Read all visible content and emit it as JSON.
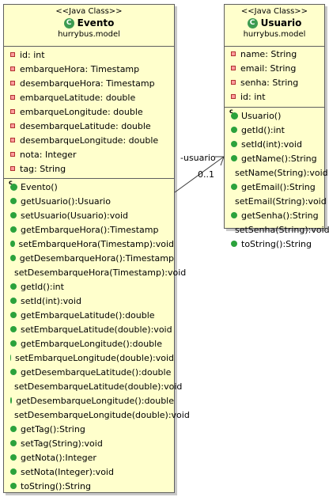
{
  "evento": {
    "stereotype": "<<Java Class>>",
    "icon": "C",
    "name": "Evento",
    "package": "hurrybus.model",
    "attributes": [
      "id: int",
      "embarqueHora: Timestamp",
      "desembarqueHora: Timestamp",
      "embarqueLatitude: double",
      "embarqueLongitude: double",
      "desembarqueLatitude: double",
      "desembarqueLongitude: double",
      "nota: Integer",
      "tag: String"
    ],
    "constructor": "Evento()",
    "methods": [
      "getUsuario():Usuario",
      "setUsuario(Usuario):void",
      "getEmbarqueHora():Timestamp",
      "setEmbarqueHora(Timestamp):void",
      "getDesembarqueHora():Timestamp",
      "setDesembarqueHora(Timestamp):void",
      "getId():int",
      "setId(int):void",
      "getEmbarqueLatitude():double",
      "setEmbarqueLatitude(double):void",
      "getEmbarqueLongitude():double",
      "setEmbarqueLongitude(double):void",
      "getDesembarqueLatitude():double",
      "setDesembarqueLatitude(double):void",
      "getDesembarqueLongitude():double",
      "setDesembarqueLongitude(double):void",
      "getTag():String",
      "setTag(String):void",
      "getNota():Integer",
      "setNota(Integer):void",
      "toString():String"
    ]
  },
  "usuario": {
    "stereotype": "<<Java Class>>",
    "icon": "C",
    "name": "Usuario",
    "package": "hurrybus.model",
    "attributes": [
      "name: String",
      "email: String",
      "senha: String",
      "id: int"
    ],
    "constructor": "Usuario()",
    "methods": [
      "getId():int",
      "setId(int):void",
      "getName():String",
      "setName(String):void",
      "getEmail():String",
      "setEmail(String):void",
      "getSenha():String",
      "setSenha(String):void",
      "toString():String"
    ]
  },
  "association": {
    "role": "-usuario",
    "multiplicity": "0..1"
  }
}
